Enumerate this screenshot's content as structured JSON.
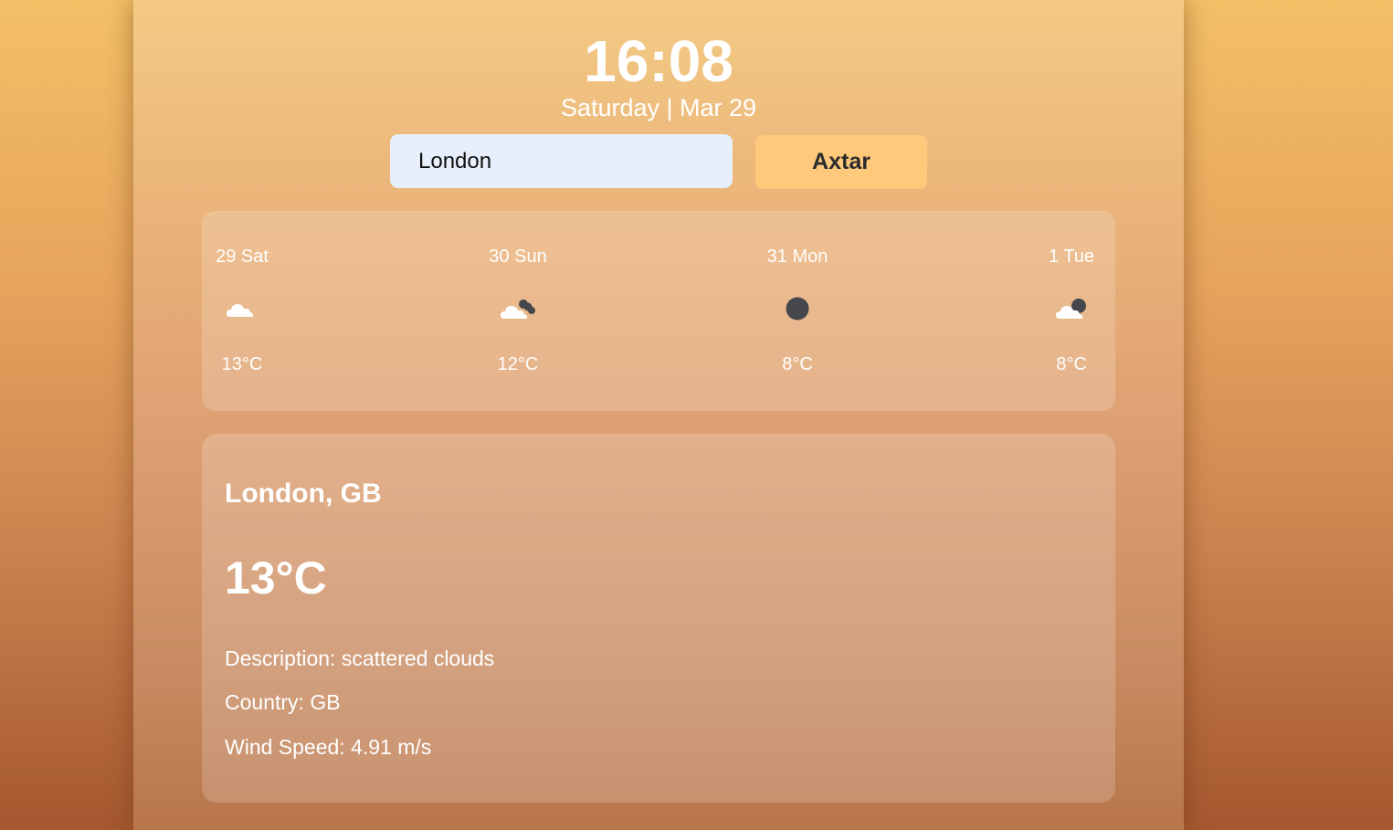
{
  "clock": {
    "time": "16:08",
    "date": "Saturday | Mar 29"
  },
  "search": {
    "value": "London",
    "button_label": "Axtar"
  },
  "forecast": [
    {
      "label": "29 Sat",
      "temp": "13°C",
      "icon": "cloud-icon"
    },
    {
      "label": "30 Sun",
      "temp": "12°C",
      "icon": "broken-clouds-icon"
    },
    {
      "label": "31 Mon",
      "temp": "8°C",
      "icon": "overcast-icon"
    },
    {
      "label": "1 Tue",
      "temp": "8°C",
      "icon": "cloud-moon-icon"
    }
  ],
  "details": {
    "city": "London, GB",
    "temp": "13°C",
    "description": "Description: scattered clouds",
    "country": "Country: GB",
    "wind": "Wind Speed: 4.91 m/s"
  },
  "colors": {
    "input_bg": "#e7effc",
    "button_bg": "#fec97a",
    "icon_dark": "#45474c",
    "icon_light": "#ffffff"
  }
}
